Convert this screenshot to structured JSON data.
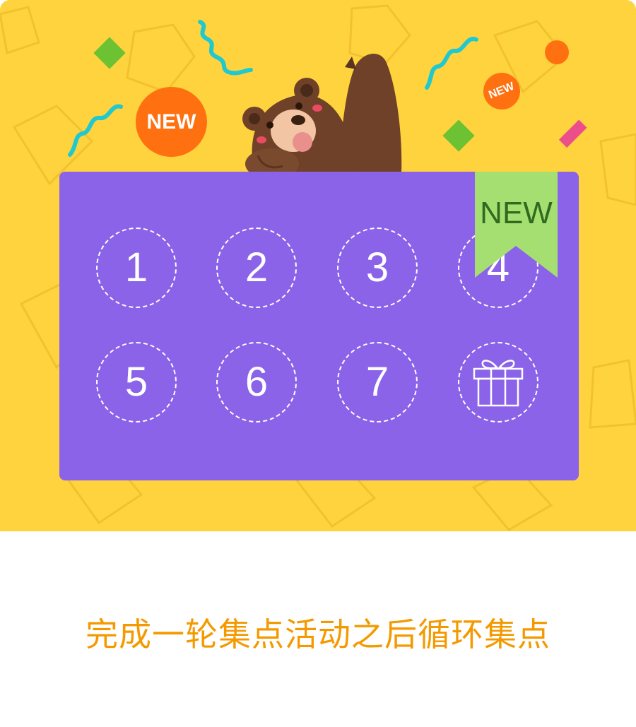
{
  "hero": {
    "background_color": "#FFD33D",
    "badge_large": "NEW",
    "badge_small": "NEW",
    "mascot": "brown-bear-waving"
  },
  "card": {
    "background_color": "#8B63E9",
    "ribbon_label": "NEW",
    "ribbon_color": "#A6DF71",
    "slots": [
      "1",
      "2",
      "3",
      "4",
      "5",
      "6",
      "7"
    ],
    "reward_icon": "gift-icon"
  },
  "caption": "完成一轮集点活动之后循环集点",
  "colors": {
    "caption": "#F49A00",
    "badge": "#FF7011",
    "confetti_wave": "#20C9CF",
    "confetti_diamond": "#6CC232",
    "confetti_pink": "#EC4E8C"
  }
}
